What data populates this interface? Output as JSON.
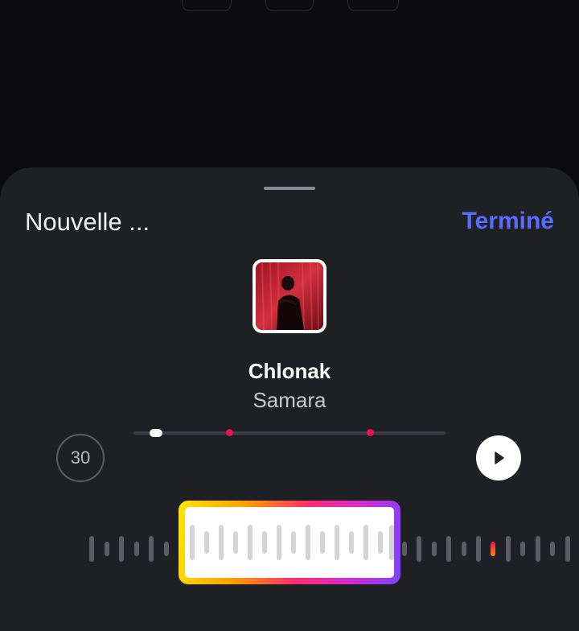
{
  "header": {
    "title": "Nouvelle ...",
    "done_label": "Terminé"
  },
  "track": {
    "title": "Chlonak",
    "artist": "Samara"
  },
  "clip": {
    "duration_label": "30"
  },
  "icons": {
    "play": "play-icon",
    "cover": "album-cover"
  },
  "colors": {
    "accent": "#5a6bff",
    "marker": "#e5135a",
    "sheet": "#1f2023",
    "selection_gradient": [
      "#ffe600",
      "#ff9a00",
      "#ff2d6f",
      "#d42bd0",
      "#7c43ff"
    ]
  }
}
